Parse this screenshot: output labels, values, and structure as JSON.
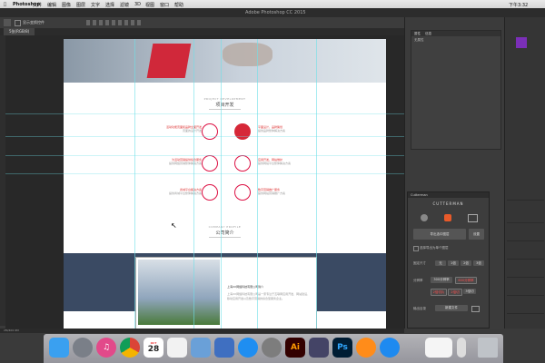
{
  "menubar": {
    "apple": "",
    "items": [
      "Photoshop",
      "文件",
      "编辑",
      "图像",
      "图层",
      "文字",
      "选择",
      "滤镜",
      "3D",
      "视图",
      "窗口",
      "帮助"
    ],
    "clock": "下午3:32"
  },
  "ps": {
    "window_title": "Adobe Photoshop CC 2015",
    "doc_tab": "5张(RGB/8)",
    "show_transform_label": "显示变换控件",
    "status": "2M/400.9M"
  },
  "webpage": {
    "services_sub": "PROJECT DEVELOPMENT",
    "services_title": "项目开发",
    "features_left": [
      {
        "title": "活动功能页面和品牌全面开发",
        "desc": "页面的设计开发"
      },
      {
        "title": "为活动营销提供综合服务",
        "desc": "提供网络营销整体解决方案"
      },
      {
        "title": "商城平台解决方案",
        "desc": "提供商城平台整体解决方案"
      }
    ],
    "features_right": [
      {
        "title": "平面设计，品牌策划",
        "desc": "提供品牌整体解决方案"
      },
      {
        "title": "应用开发，网站维护",
        "desc": "提供网站平台整体解决方案"
      },
      {
        "title": "数字营销推广服务",
        "desc": "提供网站营销推广方案"
      }
    ],
    "about_sub": "COMPANY PROFILE",
    "about_title": "公司简介",
    "about_heading": "上海XX网络科技有限公司简介",
    "about_body": "上海XX网络科技有限公司是一家专注于互联网应用开发、网站建设、移动应用开发以及数字营销的综合型服务企业。"
  },
  "panels": {
    "properties_tab": "属性",
    "info_tab": "信息",
    "no_properties": "无属性"
  },
  "cutterman": {
    "header": "Cutterman",
    "brand": "CUTTERMAN",
    "export_selected": "导出选中图层",
    "settings": "设置",
    "export_group_label": "选择导出为单个图层",
    "fixed_size_label": "固定尺寸",
    "size_buttons": [
      "无",
      "1倍",
      "2倍",
      "3倍"
    ],
    "output_label": "分辨率",
    "res_buttons": [
      "300分辨率",
      "600分辨率"
    ],
    "format_buttons": [
      "2倍切片",
      "2倍切",
      "3倍切"
    ],
    "path_label": "输出目录",
    "path_value": "新建文件"
  },
  "colors": {
    "accent_red": "#d62838",
    "guide": "#6ee0e8",
    "about_bg": "#3a4a63",
    "ps_bg": "#3a3a3a"
  },
  "dock": {
    "apps": [
      "Finder",
      "Launchpad",
      "iTunes",
      "Chrome",
      "Calendar",
      "Reminders",
      "Preview",
      "Keynote",
      "App Store",
      "System Preferences",
      "Illustrator",
      "Photoshop",
      "Firefox",
      "QuickTime",
      "Finder Window",
      "Trash"
    ],
    "calendar_day": "28",
    "calendar_month": "OCT"
  }
}
